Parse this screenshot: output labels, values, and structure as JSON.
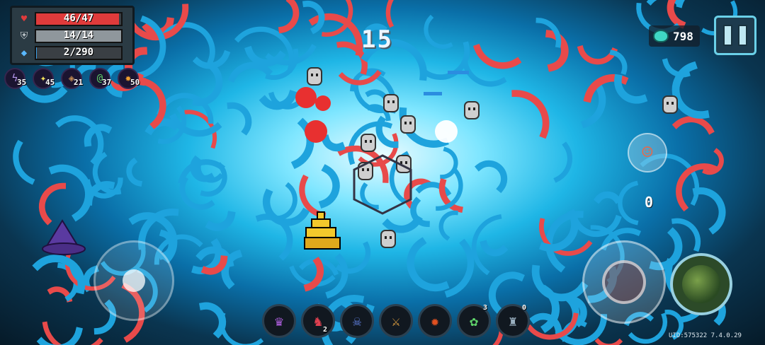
{
  "hud": {
    "hp": {
      "text": "46/47",
      "current": 46,
      "max": 47
    },
    "shield": {
      "text": "14/14",
      "current": 14,
      "max": 14
    },
    "energy": {
      "text": "2/290",
      "current": 2,
      "max": 290
    }
  },
  "buffs": [
    {
      "icon": "lightning-buff-icon",
      "count": "35",
      "color": "#9a7ae0"
    },
    {
      "icon": "star-buff-icon",
      "count": "45",
      "color": "#f2e05a"
    },
    {
      "icon": "diamond-buff-icon",
      "count": "21",
      "color": "#b07840"
    },
    {
      "icon": "swirl-buff-icon",
      "count": "37",
      "color": "#5fd36a"
    },
    {
      "icon": "fire-claw-buff-icon",
      "count": "50",
      "color": "#f0a030"
    }
  ],
  "combo": "15",
  "coins": {
    "value": "798",
    "icon": "gem-coin-icon"
  },
  "weapon_switch_count": "0",
  "pets": [
    {
      "icon": "jester-pet-icon",
      "top": "",
      "bottom": ""
    },
    {
      "icon": "red-creature-pet-icon",
      "top": "",
      "bottom": "2"
    },
    {
      "icon": "demon-pet-icon",
      "top": "",
      "bottom": ""
    },
    {
      "icon": "crossed-weapons-pet-icon",
      "top": "",
      "bottom": ""
    },
    {
      "icon": "fire-skull-pet-icon",
      "top": "",
      "bottom": ""
    },
    {
      "icon": "green-slime-pet-icon",
      "top": "3",
      "bottom": ""
    },
    {
      "icon": "knight-pet-icon",
      "top": "0",
      "bottom": ""
    }
  ],
  "version": "UID:575322 7.4.0.29",
  "colors": {
    "hp": "#e03b3b",
    "shield": "#8f979c",
    "energy": "#3aa0e8",
    "arc_blue": "#1ea3dd",
    "arc_red": "#e84a4a"
  }
}
